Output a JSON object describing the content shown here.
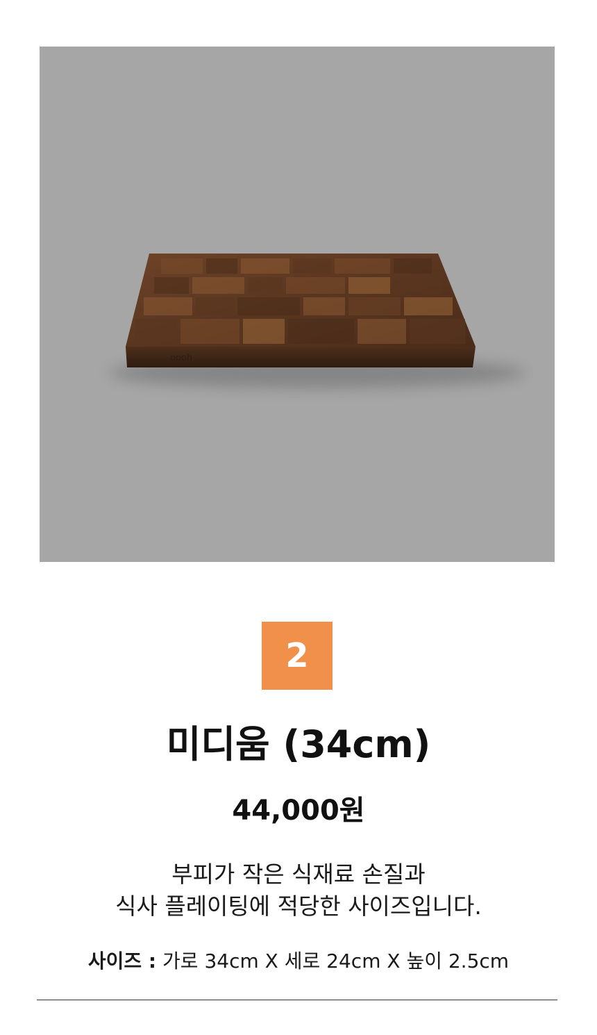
{
  "product": {
    "photo_alt": "end-grain walnut cutting board",
    "engraving": "oooh",
    "number": "2",
    "name": "미디움 (34cm)",
    "price": "44,000원",
    "description": [
      "부피가 작은 식재료 손질과",
      "식사 플레이팅에 적당한 사이즈입니다."
    ],
    "size_label": "사이즈 :",
    "size_value": "가로 34cm X 세로 24cm X 높이 2.5cm"
  },
  "colors": {
    "photo_bg": "#a6a6a6",
    "badge_bg": "#f0904a",
    "badge_text": "#ffffff",
    "text": "#111111",
    "wood_dark": "#3f2717",
    "wood_mid": "#6b4226",
    "wood_light": "#8a5a33"
  }
}
